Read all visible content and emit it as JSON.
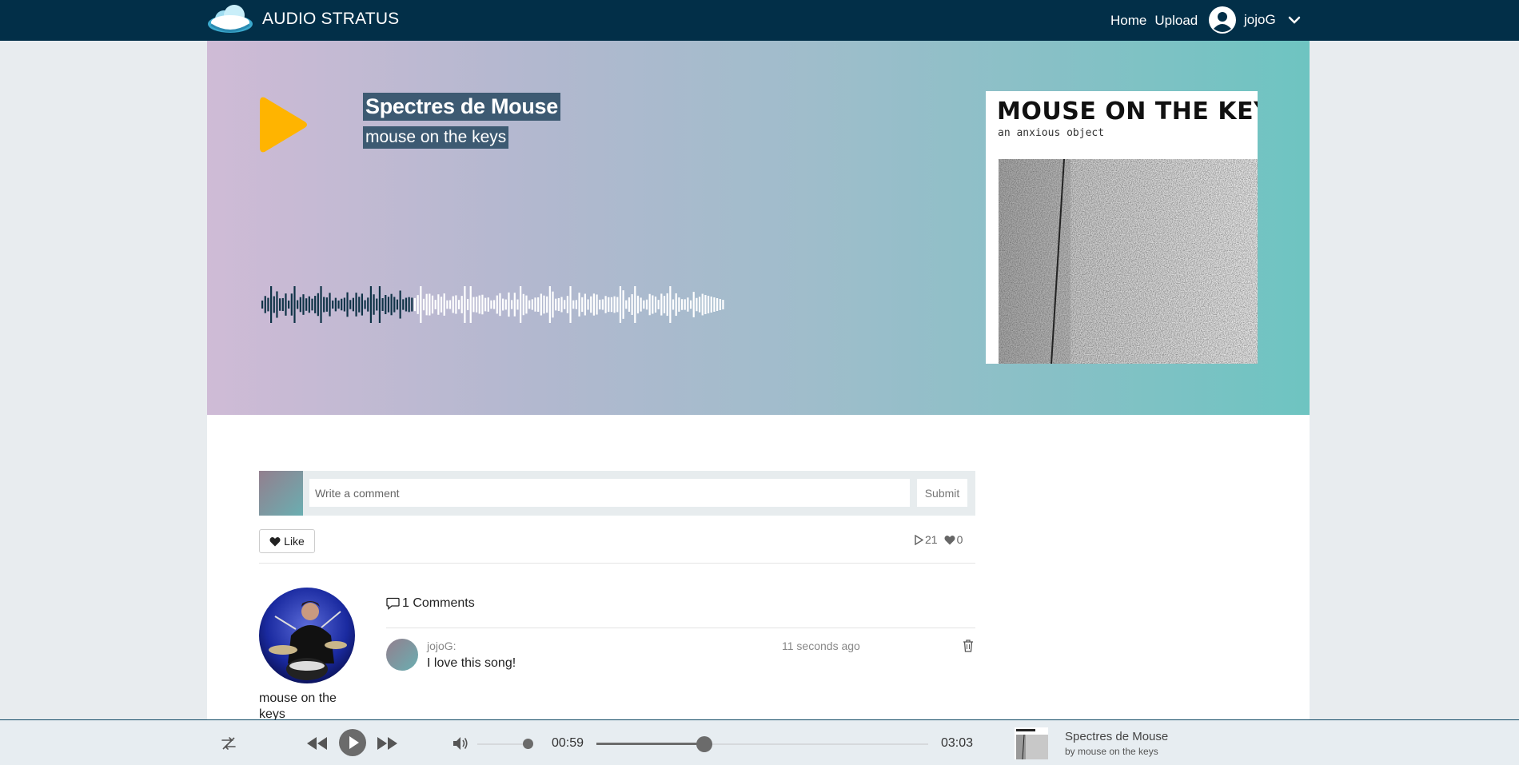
{
  "nav": {
    "brand": "AUDIO STRATUS",
    "links": [
      "Home",
      "Upload"
    ],
    "user": "jojoG"
  },
  "song": {
    "title": "Spectres de Mouse",
    "artist": "mouse on the keys"
  },
  "cover": {
    "band": "MOUSE ON THE KEYS",
    "album": "an anxious object"
  },
  "comment_form": {
    "placeholder": "Write a comment",
    "submit": "Submit"
  },
  "actions": {
    "like": "Like",
    "plays": "21",
    "likes": "0"
  },
  "artist": {
    "name": "mouse on the keys"
  },
  "comments": {
    "header": "1 Comments",
    "items": [
      {
        "user": "jojoG:",
        "time": "11 seconds ago",
        "text": "I love this song!"
      }
    ]
  },
  "player": {
    "current_time": "00:59",
    "duration": "03:03",
    "progress": 0.325,
    "volume": 0.9,
    "now_playing_title": "Spectres de Mouse",
    "now_playing_artist": "by mouse on the keys"
  },
  "colors": {
    "navbar": "#022f48",
    "play_accent": "#ffb400",
    "title_highlight": "#3d5a72",
    "waveform_played": "#0f3347",
    "waveform_unplayed": "#ffffff"
  },
  "icons": [
    "cloud-logo-icon",
    "user-circle-icon",
    "chevron-down-icon",
    "play-icon",
    "heart-icon",
    "comment-icon",
    "trash-icon",
    "repeat-icon",
    "rewind-icon",
    "fast-forward-icon",
    "volume-icon"
  ]
}
